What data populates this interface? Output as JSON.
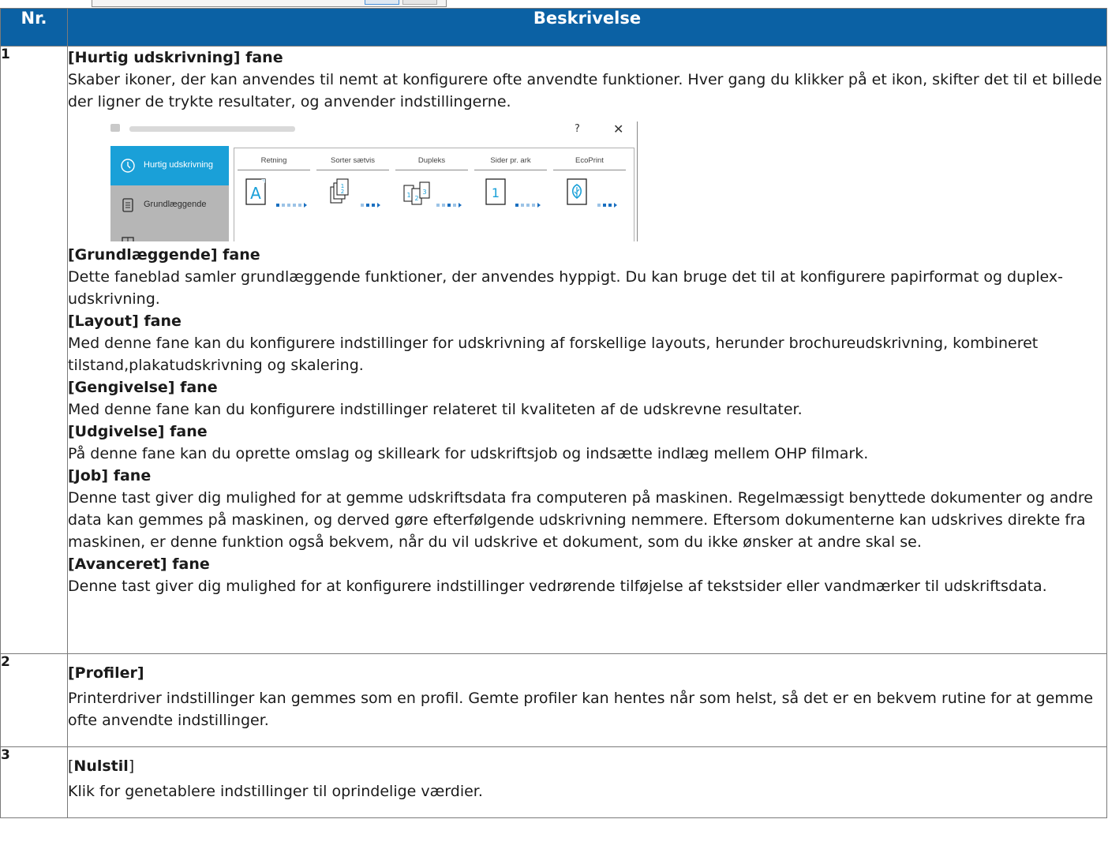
{
  "table": {
    "header": {
      "nr": "Nr.",
      "description": "Beskrivelse"
    },
    "rows": [
      {
        "nr": "1",
        "sections": [
          {
            "title": "[Hurtig udskrivning] fane",
            "text": "Skaber ikoner, der kan anvendes til nemt at konfigurere ofte anvendte funktioner. Hver gang du klikker på et ikon, skifter det til et billede der ligner de trykte resultater, og anvender indstillingerne."
          },
          {
            "title": "[Grundlæggende] fane",
            "text": "Dette faneblad samler grundlæggende funktioner, der anvendes hyppigt. Du kan bruge det til at konfigurere papirformat og duplex-udskrivning."
          },
          {
            "title": "[Layout] fane",
            "text": "Med denne fane kan du konfigurere indstillinger for udskrivning af forskellige layouts, herunder brochureudskrivning, kombineret tilstand,plakatudskrivning og skalering."
          },
          {
            "title": "[Gengivelse] fane",
            "text": "Med denne fane kan du konfigurere indstillinger relateret til kvaliteten af de udskrevne resultater."
          },
          {
            "title": "[Udgivelse] fane",
            "text": "På denne fane kan du oprette omslag og skilleark for udskriftsjob og indsætte indlæg mellem OHP filmark."
          },
          {
            "title": "[Job] fane",
            "text": "Denne tast giver dig mulighed for at gemme udskriftsdata fra computeren på maskinen. Regelmæssigt benyttede dokumenter og andre data kan gemmes på maskinen, og derved gøre efterfølgende udskrivning nemmere. Eftersom dokumenterne kan udskrives direkte fra maskinen, er denne funktion også bekvem, når du vil udskrive et dokument, som du ikke ønsker at andre skal se."
          },
          {
            "title": "[Avanceret] fane",
            "text": "Denne tast giver dig mulighed for at konfigurere indstillinger vedrørende tilføjelse af tekstsider eller vandmærker til udskriftsdata."
          }
        ]
      },
      {
        "nr": "2",
        "title": "[Profiler]",
        "text": "Printerdriver indstillinger kan gemmes som en profil. Gemte profiler kan hentes når som helst, så det er en bekvem rutine for at gemme ofte anvendte indstillinger."
      },
      {
        "nr": "3",
        "title_open": "[",
        "title_bold": "Nulstil",
        "title_close": "]",
        "text": "Klik for genetablere indstillinger til oprindelige værdier."
      }
    ]
  },
  "dialog": {
    "help_glyph": "?",
    "close_glyph": "✕",
    "nav": [
      {
        "label": "Hurtig udskrivning",
        "icon": "clock-icon",
        "active": true
      },
      {
        "label": "Grundlæggende",
        "icon": "document-icon",
        "active": false
      },
      {
        "label": "",
        "icon": "layout-icon",
        "active": false
      }
    ],
    "columns": [
      {
        "label": "Retning",
        "icon": "orientation-icon",
        "glyph": "A"
      },
      {
        "label": "Sorter sætvis",
        "icon": "collate-icon"
      },
      {
        "label": "Dupleks",
        "icon": "duplex-icon"
      },
      {
        "label": "Sider pr. ark",
        "icon": "pages-per-sheet-icon",
        "glyph": "1"
      },
      {
        "label": "EcoPrint",
        "icon": "ecoprint-icon"
      }
    ],
    "accent_color": "#1aa0d8"
  },
  "colors": {
    "header_bg": "#0b61a4",
    "border": "#7a7a7a"
  }
}
